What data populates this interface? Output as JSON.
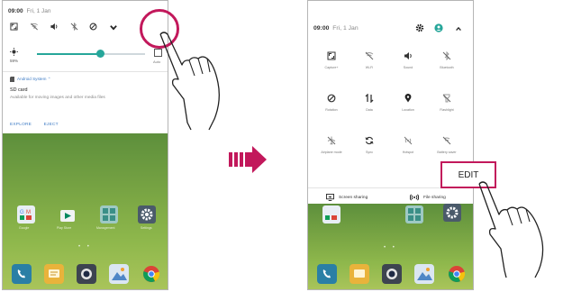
{
  "left_phone": {
    "status": {
      "time": "09:00",
      "date": "Fri, 1 Jan"
    },
    "quick_icons": [
      "autorotate-icon",
      "wifi-off-icon",
      "sound-icon",
      "bluetooth-off-icon",
      "block-icon",
      "chevron-down-icon"
    ],
    "brightness": {
      "level_label": "59%",
      "level_value": 0.59,
      "auto_label": "Auto"
    },
    "notification": {
      "source": "Android System ⌃",
      "title": "SD card",
      "detail": "Available for moving images and other media files",
      "actions": [
        "EXPLORE",
        "EJECT"
      ]
    },
    "home_labels": [
      "Google",
      "Play Store",
      "Management",
      "Settings"
    ]
  },
  "right_phone": {
    "status": {
      "time": "09:00",
      "date": "Fri, 1 Jan"
    },
    "tiles": [
      {
        "icon": "capture-icon",
        "label": "Capture+"
      },
      {
        "icon": "wifi-off-icon",
        "label": "Wi-Fi"
      },
      {
        "icon": "sound-icon",
        "label": "Sound"
      },
      {
        "icon": "bluetooth-off-icon",
        "label": "Bluetooth"
      },
      {
        "icon": "rotation-icon",
        "label": "Rotation"
      },
      {
        "icon": "data-icon",
        "label": "Data"
      },
      {
        "icon": "location-icon",
        "label": "Location"
      },
      {
        "icon": "flashlight-icon",
        "label": "Flashlight"
      },
      {
        "icon": "airplane-icon",
        "label": "Airplane mode"
      },
      {
        "icon": "sync-icon",
        "label": "Sync"
      },
      {
        "icon": "hotspot-icon",
        "label": "Hotspot"
      },
      {
        "icon": "battery-saver-icon",
        "label": "Battery saver"
      }
    ],
    "edit_label": "EDIT",
    "screen_sharing_label": "Screen sharing",
    "file_sharing_label": "File sharing"
  },
  "colors": {
    "highlight": "#c2185b",
    "arrow": "#c2185b",
    "accent": "#26a69a"
  }
}
